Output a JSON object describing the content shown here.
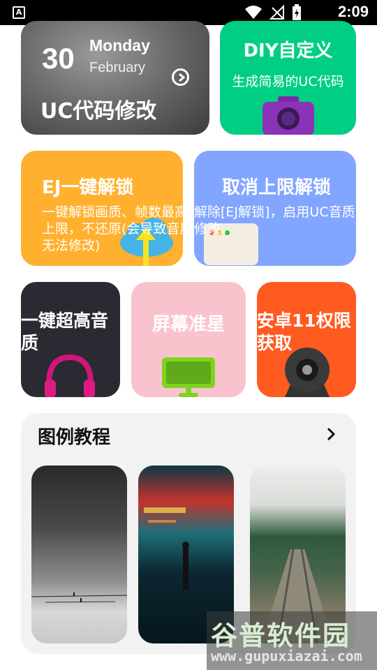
{
  "status_bar": {
    "app_icon_text": "A",
    "time": "2:09"
  },
  "date_card": {
    "day": "30",
    "weekday": "Monday",
    "month": "February",
    "title": "UC代码修改"
  },
  "diy_card": {
    "title": "DIY自定义",
    "subtitle": "生成简易的UC代码",
    "icon": "camera-icon"
  },
  "ej_card": {
    "title": "EJ一键解锁",
    "description": "一键解锁画质、帧数最高上限，不还原(会导致音质无法修改)",
    "icon": "cloud-upload-icon"
  },
  "cancel_card": {
    "title": "取消上限解锁",
    "description": "解除[EJ解锁]，启用UC音质修改。",
    "icon": "browser-window-icon"
  },
  "audio_card": {
    "title": "一键超高音质",
    "icon": "headphones-icon"
  },
  "screen_card": {
    "title": "屏幕准星",
    "icon": "monitor-icon"
  },
  "android_card": {
    "title": "安卓11权限获取",
    "icon": "webcam-icon"
  },
  "tutorials": {
    "title": "图例教程",
    "thumbnails": [
      "foggy-landscape-photo",
      "neon-street-photo",
      "railway-forest-photo"
    ]
  },
  "watermark": {
    "text": "谷普软件园",
    "url": "www.gupuxiazai.com"
  },
  "colors": {
    "diy": "#00cf83",
    "ej": "#ffb02e",
    "cancel": "#82a5ff",
    "audio": "#2a2a33",
    "screen": "#f9c3cd",
    "android": "#ff5a20"
  }
}
